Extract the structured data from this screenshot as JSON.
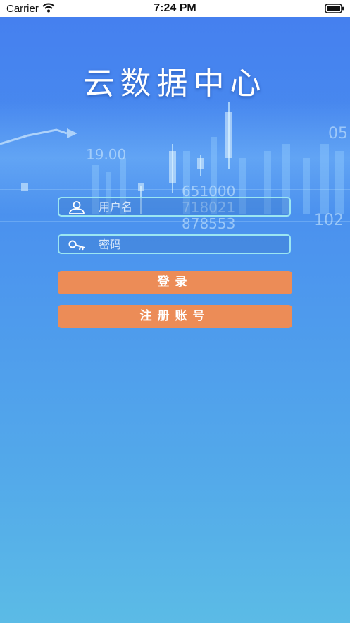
{
  "status_bar": {
    "carrier": "Carrier",
    "time": "7:24 PM"
  },
  "app": {
    "title": "云数据中心"
  },
  "background": {
    "numbers": [
      "19.00",
      "651000",
      "718021",
      "878553",
      "05",
      "102"
    ]
  },
  "login": {
    "username_placeholder": "用户名",
    "username_value": "",
    "password_placeholder": "密码",
    "password_value": "",
    "login_label": "登录",
    "register_label": "注册账号"
  },
  "colors": {
    "button": "#ec8c57",
    "field_border": "#9be6f2",
    "gradient_top": "#4580ef",
    "gradient_bottom": "#5bbbe6"
  },
  "icons": [
    "wifi-icon",
    "battery-icon",
    "user-icon",
    "key-icon"
  ]
}
